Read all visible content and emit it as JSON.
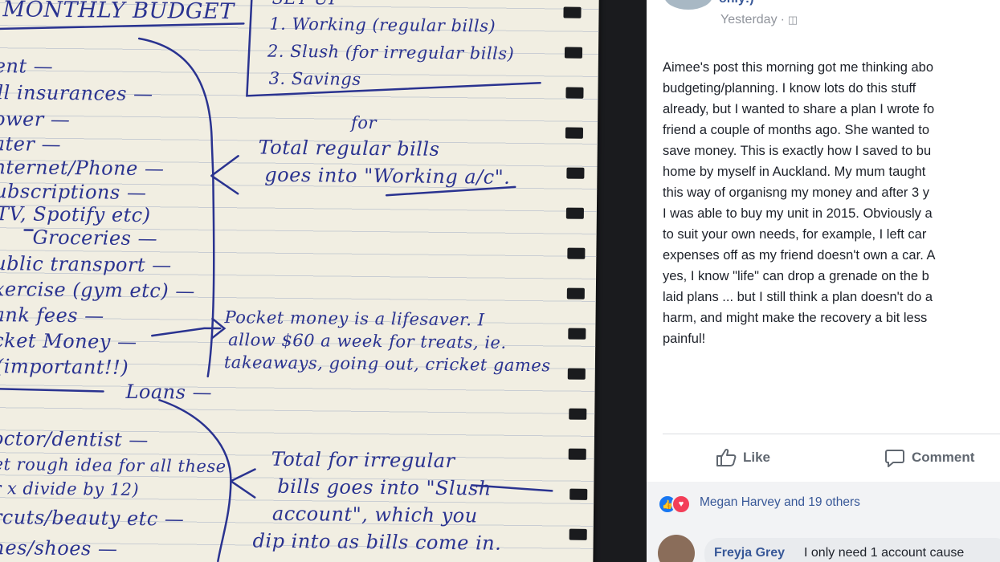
{
  "notebook": {
    "title": "MONTHLY BUDGET",
    "accounts_box": {
      "header": "SET UP",
      "items": [
        "1. Working (regular bills)",
        "2. Slush (for irregular bills)",
        "3. Savings"
      ]
    },
    "regular_list": [
      "ent —",
      "ll insurances —",
      "ower —",
      "ater —",
      "nternet/Phone —",
      "ubscriptions —",
      "TV, Spotify etc)",
      "Groceries —",
      "ublic transport —",
      "xercise (gym etc) —",
      "ank fees —",
      "cket Money —",
      "(important!!)",
      "Loans —"
    ],
    "irregular_list": [
      "octor/dentist —",
      "et rough idea for all these",
      "r x divide by 12)",
      "rcuts/beauty etc —",
      "hes/shoes —"
    ],
    "note_regular_fix": "for",
    "note_regular": [
      "Total regular bills",
      "goes into \"Working a/c\"."
    ],
    "note_pocket": [
      "Pocket money is a lifesaver. I",
      "allow $60 a week for treats, ie.",
      "takeaways, going out, cricket games"
    ],
    "note_irregular": [
      "Total for irregular",
      "bills goes into \"Slush",
      "account\", which you",
      "dip into as bills come in."
    ]
  },
  "post": {
    "author_partial": "only!)",
    "timestamp": "Yesterday",
    "privacy_icon": "globe-icon",
    "lines": [
      "Aimee's post this morning got me thinking abo",
      "budgeting/planning. I know lots do this stuff",
      "already, but I wanted to share a plan I wrote fo",
      "friend a couple of months ago. She wanted to",
      "save money. This is exactly how I saved to bu",
      "home by myself in Auckland. My mum taught",
      "this way of organisng my money and after 3 y",
      "I was able to buy my unit in 2015. Obviously a",
      "to suit your own needs, for example, I left car",
      "expenses off as my friend doesn't own a car. A",
      "yes, I know \"life\" can drop a grenade on the b",
      "laid plans ... but I still think a plan doesn't do a",
      "harm, and might make the recovery a bit less",
      "painful!"
    ],
    "actions": {
      "like": "Like",
      "comment": "Comment"
    },
    "reactions_text": "Megan Harvey and 19 others",
    "comment": {
      "author": "Freyja Grey",
      "text": "I only need 1 account cause"
    },
    "colors": {
      "link": "#385898",
      "text": "#1d2129",
      "muted": "#90949c",
      "bar": "#f2f3f5"
    }
  }
}
